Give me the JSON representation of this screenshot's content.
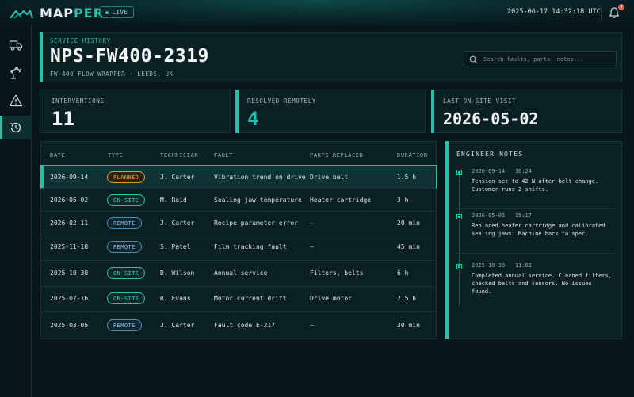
{
  "app": {
    "logo_part1": "MAP",
    "logo_part2": "PER",
    "live_label": "LIVE",
    "clock": "2025-06-17 14:32:18 UTC",
    "notification_count": "3"
  },
  "sidebar": {
    "items": [
      {
        "icon": "truck-icon",
        "active": false
      },
      {
        "icon": "robot-arm-icon",
        "active": false
      },
      {
        "icon": "warning-icon",
        "active": false
      },
      {
        "icon": "history-icon",
        "active": true
      }
    ]
  },
  "header": {
    "label": "SERVICE HISTORY",
    "title": "NPS-FW400-2319",
    "subtitle": "FW-400 FLOW WRAPPER  ·  LEEDS, UK",
    "search_placeholder": "Search faults, parts, notes..."
  },
  "stats": [
    {
      "label": "INTERVENTIONS",
      "value": "11"
    },
    {
      "label": "RESOLVED REMOTELY",
      "value": "4"
    },
    {
      "label": "LAST ON-SITE VISIT",
      "value": "2026-05-02"
    }
  ],
  "table": {
    "headers": [
      "DATE",
      "TYPE",
      "TECHNICIAN",
      "FAULT",
      "PARTS REPLACED",
      "DURATION"
    ],
    "rows": [
      {
        "date": "2026-09-14",
        "type": "PLANNED",
        "tech": "J. Carter",
        "fault": "Vibration trend on drive",
        "parts": "Drive belt",
        "duration": "1.5 h"
      },
      {
        "date": "2026-05-02",
        "type": "ON-SITE",
        "tech": "M. Reid",
        "fault": "Sealing jaw temperature",
        "parts": "Heater cartridge",
        "duration": "3 h"
      },
      {
        "date": "2026-02-11",
        "type": "REMOTE",
        "tech": "J. Carter",
        "fault": "Recipe parameter error",
        "parts": "—",
        "duration": "20 min"
      },
      {
        "date": "2025-11-18",
        "type": "REMOTE",
        "tech": "S. Patel",
        "fault": "Film tracking fault",
        "parts": "—",
        "duration": "45 min"
      },
      {
        "date": "2025-10-30",
        "type": "ON-SITE",
        "tech": "D. Wilson",
        "fault": "Annual service",
        "parts": "Filters, belts",
        "duration": "6 h"
      },
      {
        "date": "2025-07-16",
        "type": "ON-SITE",
        "tech": "R. Evans",
        "fault": "Motor current drift",
        "parts": "Drive motor",
        "duration": "2.5 h"
      },
      {
        "date": "2025-03-05",
        "type": "REMOTE",
        "tech": "J. Carter",
        "fault": "Fault code E-217",
        "parts": "—",
        "duration": "30 min"
      }
    ]
  },
  "notes": {
    "title": "ENGINEER NOTES",
    "items": [
      {
        "date": "2026-09-14",
        "time": "10:24",
        "text": "Tension set to 42 N after belt change. Customer runs 2 shifts."
      },
      {
        "date": "2026-05-02",
        "time": "15:17",
        "text": "Replaced heater cartridge and calibrated sealing jaws. Machine back to spec."
      },
      {
        "date": "2025-10-30",
        "time": "11:03",
        "text": "Completed annual service. Cleaned filters, checked belts and sensors. No issues found."
      }
    ]
  },
  "colors": {
    "accent": "#27c0a8",
    "planned": "#e9b04c",
    "remote": "#8cc4de",
    "alert": "#e25a4b"
  }
}
